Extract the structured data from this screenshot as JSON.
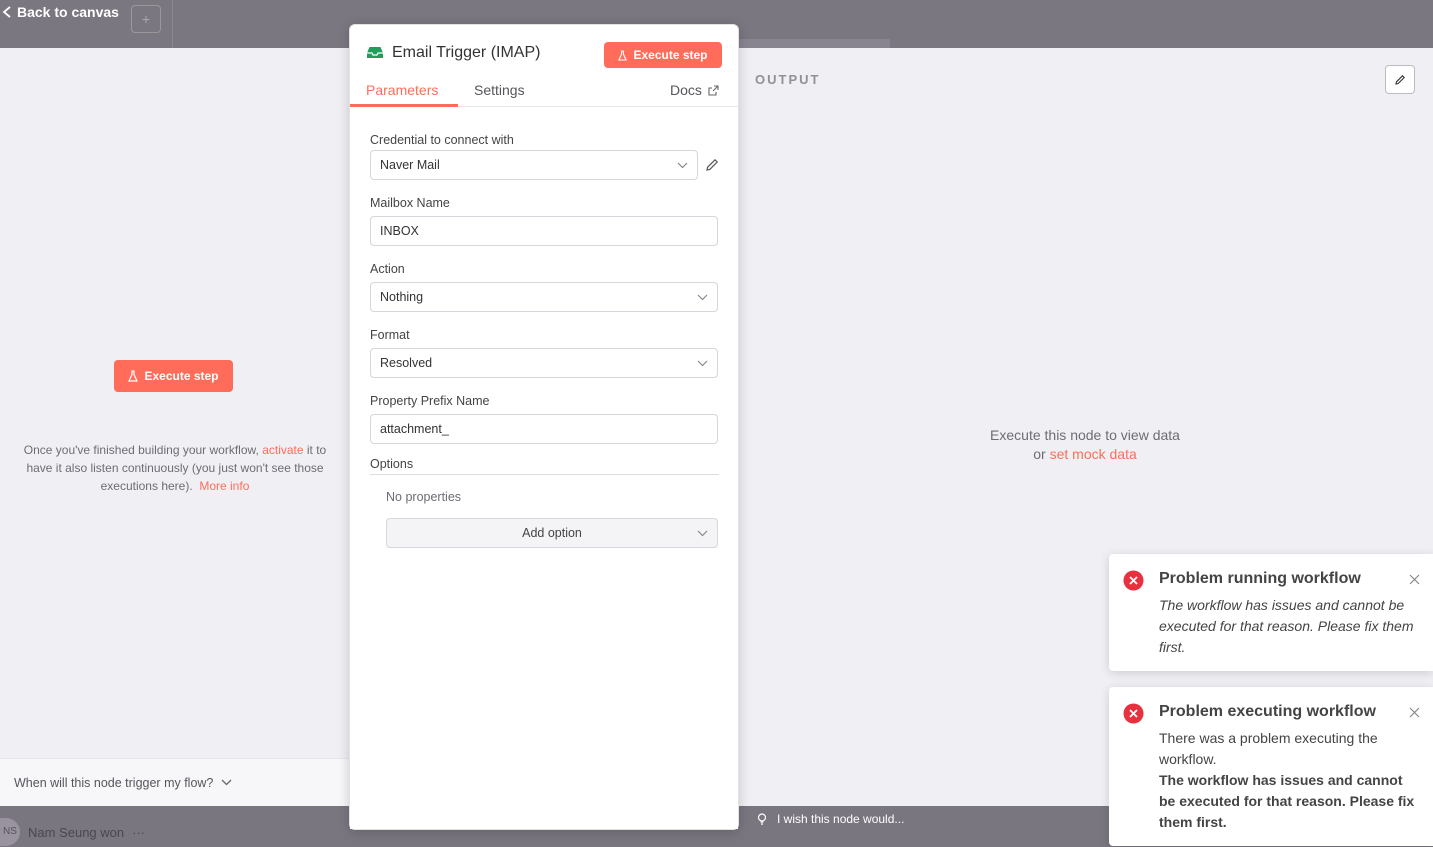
{
  "canvas": {
    "back_label": "Back to canvas",
    "plus_label": "+",
    "user_initials": "NS",
    "user_name": "Nam Seung won",
    "user_menu": "···",
    "feedback_label": "I wish this node would..."
  },
  "input_panel": {
    "execute_label": "Execute step",
    "hint_before": "Once you've finished building your workflow, ",
    "hint_activate": "activate",
    "hint_after": " it to have it also listen continuously (you just won't see those executions here).",
    "hint_more": "More info",
    "trigger_question": "When will this node trigger my flow?"
  },
  "node": {
    "title": "Email Trigger (IMAP)",
    "execute_label": "Execute step",
    "tabs": {
      "parameters": "Parameters",
      "settings": "Settings",
      "docs": "Docs"
    },
    "fields": {
      "credential_label": "Credential to connect with",
      "credential_value": "Naver Mail",
      "mailbox_label": "Mailbox Name",
      "mailbox_value": "INBOX",
      "action_label": "Action",
      "action_value": "Nothing",
      "format_label": "Format",
      "format_value": "Resolved",
      "prefix_label": "Property Prefix Name",
      "prefix_value": "attachment_",
      "options_label": "Options",
      "no_properties": "No properties",
      "add_option": "Add option"
    }
  },
  "output_panel": {
    "title": "OUTPUT",
    "message_line1": "Execute this node to view data",
    "message_or": "or ",
    "message_link": "set mock data"
  },
  "toasts": [
    {
      "title": "Problem running workflow",
      "body": "The workflow has issues and cannot be executed for that reason. Please fix them first."
    },
    {
      "title": "Problem executing workflow",
      "body": "There was a problem executing the workflow.",
      "body_bold": "The workflow has issues and cannot be executed for that reason. Please fix them first."
    }
  ],
  "colors": {
    "accent": "#ff6d5a",
    "error": "#e8313f"
  },
  "icons": [
    "back-arrow-icon",
    "flask-icon",
    "inbox-icon",
    "external-link-icon",
    "chevron-down-icon",
    "pencil-icon",
    "error-icon",
    "close-icon",
    "lightbulb-icon"
  ]
}
